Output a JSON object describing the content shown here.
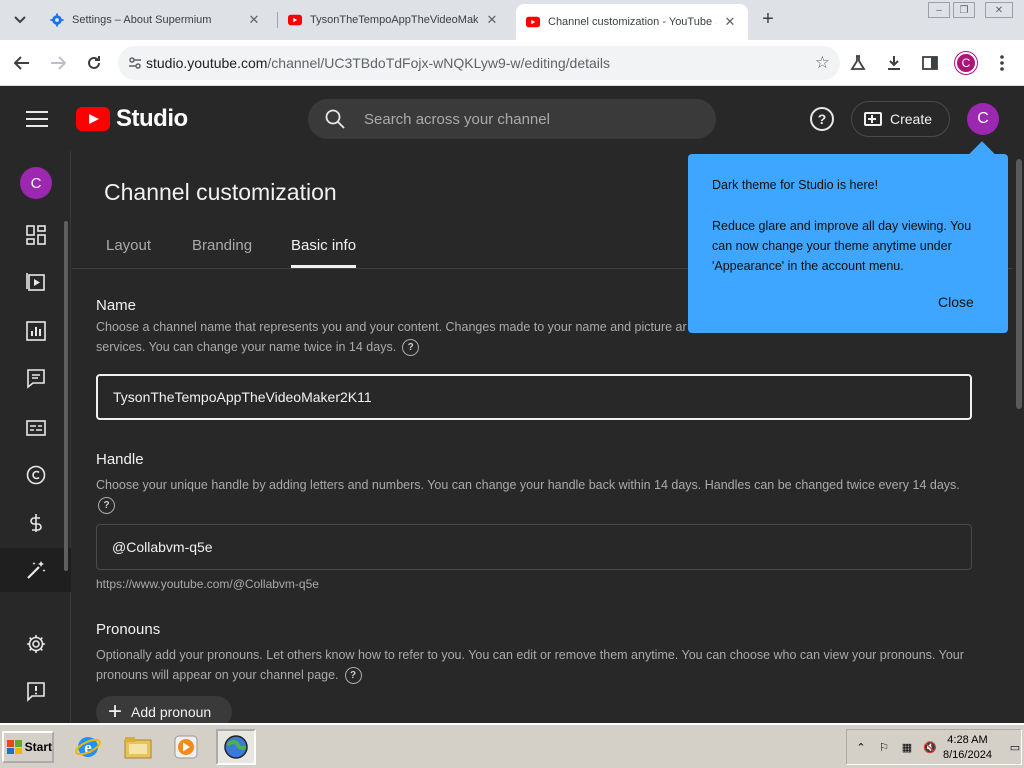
{
  "browser": {
    "tabs": [
      {
        "title": "Settings – About Supermium",
        "favicon": "gear-icon",
        "active": false
      },
      {
        "title": "TysonTheTempoAppTheVideoMaker",
        "favicon": "youtube-icon",
        "active": false
      },
      {
        "title": "Channel customization - YouTube Studio",
        "favicon": "youtube-icon",
        "active": true
      }
    ],
    "url_host": "studio.youtube.com",
    "url_path": "/channel/UC3TBdoTdFojx-wNQKLyw9-w/editing/details",
    "profile_initial": "C"
  },
  "header": {
    "logo_text": "Studio",
    "search_placeholder": "Search across your channel",
    "create_label": "Create",
    "account_initial": "C"
  },
  "nav": {
    "avatar_initial": "C",
    "items": [
      {
        "name": "dashboard",
        "icon": "dashboard-icon"
      },
      {
        "name": "content",
        "icon": "content-icon"
      },
      {
        "name": "analytics",
        "icon": "analytics-icon"
      },
      {
        "name": "comments",
        "icon": "comments-icon"
      },
      {
        "name": "subtitles",
        "icon": "subtitles-icon"
      },
      {
        "name": "copyright",
        "icon": "copyright-icon"
      },
      {
        "name": "earn",
        "icon": "dollar-icon"
      },
      {
        "name": "customization",
        "icon": "magic-wand-icon",
        "active": true
      },
      {
        "name": "settings",
        "icon": "gear-icon"
      },
      {
        "name": "send-feedback",
        "icon": "feedback-icon"
      }
    ]
  },
  "page": {
    "title": "Channel customization",
    "tabs": [
      "Layout",
      "Branding",
      "Basic info"
    ],
    "active_tab": "Basic info"
  },
  "name_section": {
    "title": "Name",
    "description": "Choose a channel name that represents you and your content. Changes made to your name and picture ar",
    "description_2": "services. You can change your name twice in 14 days.",
    "value": "TysonTheTempoAppTheVideoMaker2K11"
  },
  "handle_section": {
    "title": "Handle",
    "description": "Choose your unique handle by adding letters and numbers. You can change your handle back within 14 days. Handles can be changed twice every 14 days.",
    "value": "@Collabvm-q5e",
    "url": "https://www.youtube.com/@Collabvm-q5e"
  },
  "pronouns_section": {
    "title": "Pronouns",
    "description": "Optionally add your pronouns. Let others know how to refer to you. You can edit or remove them anytime. You can choose who can view your pronouns. Your pronouns will appear on your channel page.",
    "add_label": "Add pronoun"
  },
  "promo": {
    "title": "Dark theme for Studio is here!",
    "body": "Reduce glare and improve all day viewing. You can now change your theme anytime under 'Appearance' in the account menu.",
    "close_label": "Close"
  },
  "taskbar": {
    "start_label": "Start",
    "time": "4:28 AM",
    "date": "8/16/2024"
  },
  "colors": {
    "studio_bg": "#282828",
    "promo_blue": "#3ea6ff",
    "youtube_red": "#ff0000",
    "avatar_purple": "#9c27b0"
  }
}
